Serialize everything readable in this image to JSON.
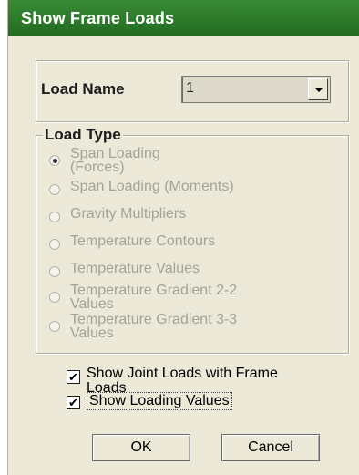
{
  "window": {
    "title": "Show Frame Loads"
  },
  "load_name": {
    "label": "Load Name",
    "value": "1"
  },
  "load_type": {
    "legend": "Load Type",
    "options": [
      {
        "label": "Span Loading\n(Forces)",
        "checked": true
      },
      {
        "label": "Span Loading (Moments)",
        "checked": false
      },
      {
        "label": "Gravity Multipliers",
        "checked": false
      },
      {
        "label": "Temperature Contours",
        "checked": false
      },
      {
        "label": "Temperature Values",
        "checked": false
      },
      {
        "label": "Temperature Gradient 2-2\nValues",
        "checked": false
      },
      {
        "label": "Temperature Gradient 3-3\nValues",
        "checked": false
      }
    ]
  },
  "options": {
    "show_joint_loads": {
      "label": "Show Joint Loads with Frame\nLoads",
      "checked": true
    },
    "show_loading_values": {
      "label": "Show Loading Values",
      "checked": true
    }
  },
  "buttons": {
    "ok": "OK",
    "cancel": "Cancel"
  }
}
